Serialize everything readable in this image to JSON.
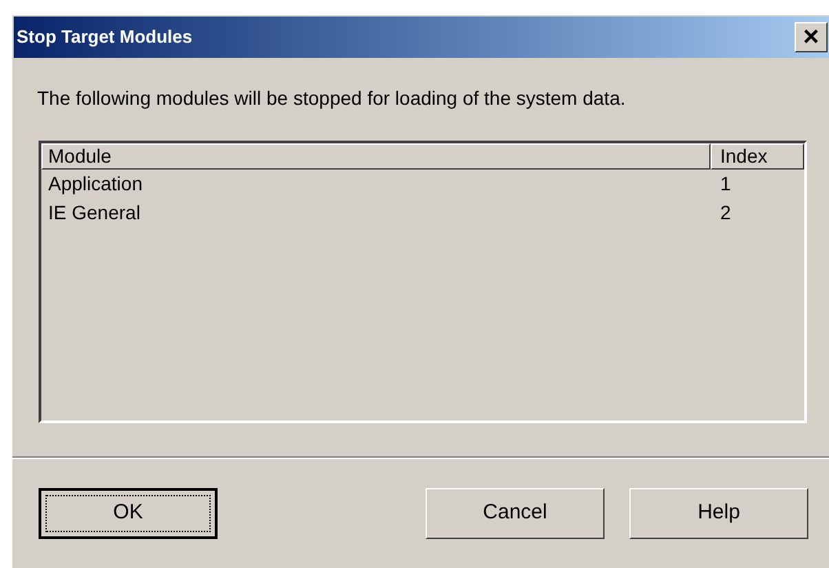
{
  "window": {
    "title": "Stop Target Modules",
    "close": "×"
  },
  "message": "The following modules will be stopped for loading of the system data.",
  "table": {
    "columns": [
      "Module",
      "Index"
    ],
    "rows": [
      {
        "module": "Application",
        "index": "1"
      },
      {
        "module": "IE General",
        "index": "2"
      }
    ]
  },
  "buttons": [
    {
      "label": "OK",
      "default": true
    },
    {
      "label": "Cancel",
      "default": false
    },
    {
      "label": "Help",
      "default": false
    }
  ]
}
